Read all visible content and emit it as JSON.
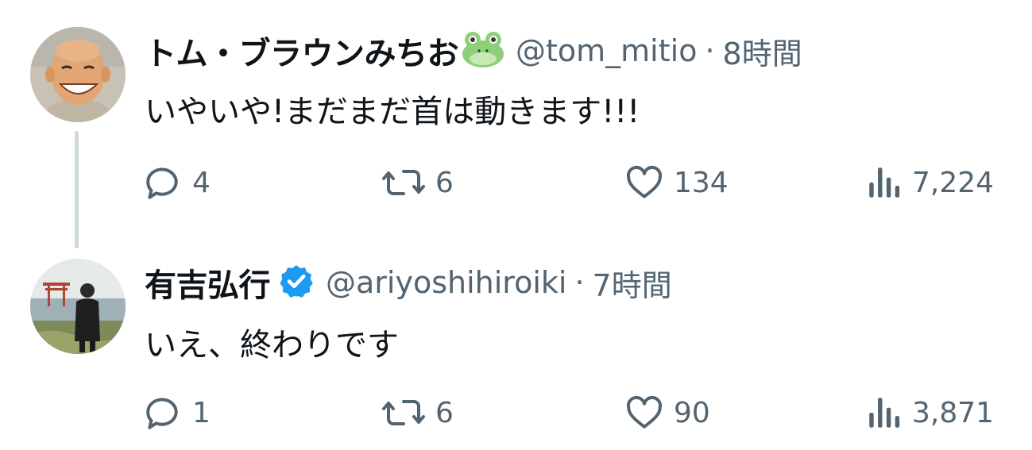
{
  "tweets": [
    {
      "display_name": "トム・ブラウンみちお",
      "name_emoji_icon": "frog-face-icon",
      "handle": "@tom_mitio",
      "separator": "·",
      "time": "8時間",
      "text": "いやいや!まだまだ首は動きます!!!",
      "replies": "4",
      "retweets": "6",
      "likes": "134",
      "views": "7,224"
    },
    {
      "display_name": "有吉弘行",
      "verified": true,
      "verified_color": "#1d9bf0",
      "handle": "@ariyoshihiroiki",
      "separator": "·",
      "time": "7時間",
      "text": "いえ、終わりです",
      "replies": "1",
      "retweets": "6",
      "likes": "90",
      "views": "3,871"
    }
  ],
  "colors": {
    "text_primary": "#0f1419",
    "text_secondary": "#536471",
    "thread_line": "#cfd9de",
    "verified": "#1d9bf0"
  }
}
